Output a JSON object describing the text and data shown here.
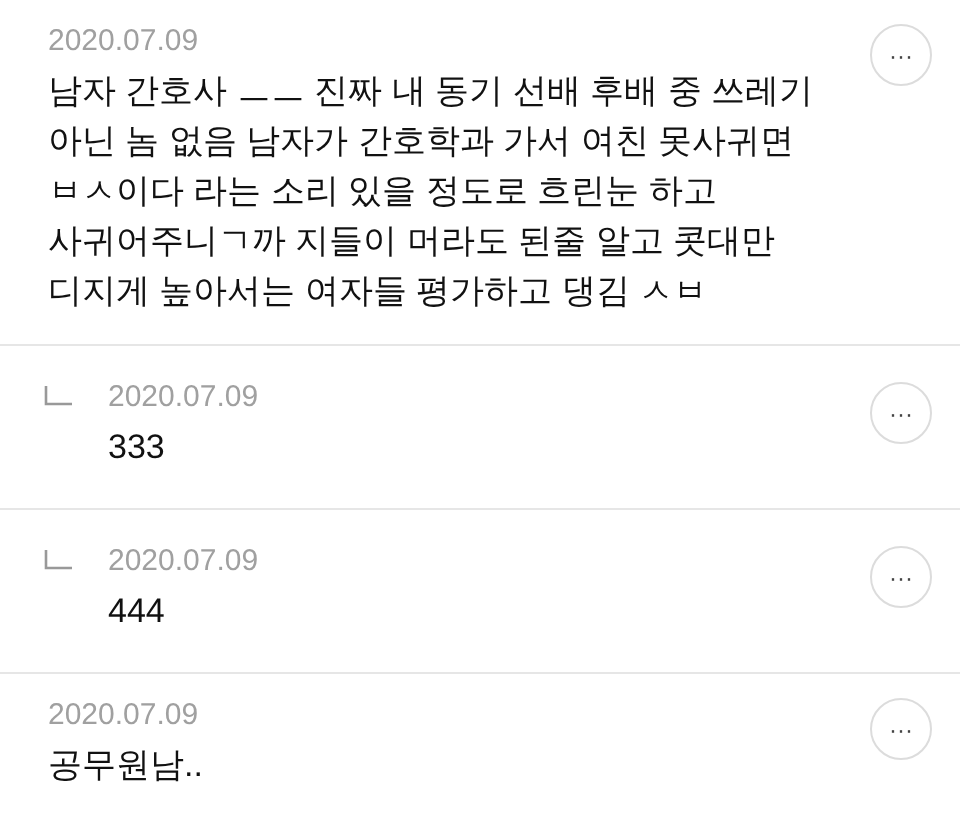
{
  "comments": [
    {
      "kind": "comment",
      "date": "2020.07.09",
      "text": "남자 간호사 ㅡㅡ 진짜 내 동기 선배 후배 중 쓰레기 아닌 놈 없음 남자가 간호학과 가서 여친 못사귀면 ㅂㅅ이다 라는 소리 있을 정도로 흐린눈 하고 사귀어주니ㄱ까 지들이 머라도 된줄 알고 콧대만 디지게 높아서는 여자들 평가하고 댕김 ㅅㅂ",
      "menu": "···"
    },
    {
      "kind": "reply",
      "date": "2020.07.09",
      "text": "333",
      "menu": "···"
    },
    {
      "kind": "reply",
      "date": "2020.07.09",
      "text": "444",
      "menu": "···"
    },
    {
      "kind": "comment",
      "date": "2020.07.09",
      "text": "공무원남..",
      "menu": "···"
    }
  ]
}
